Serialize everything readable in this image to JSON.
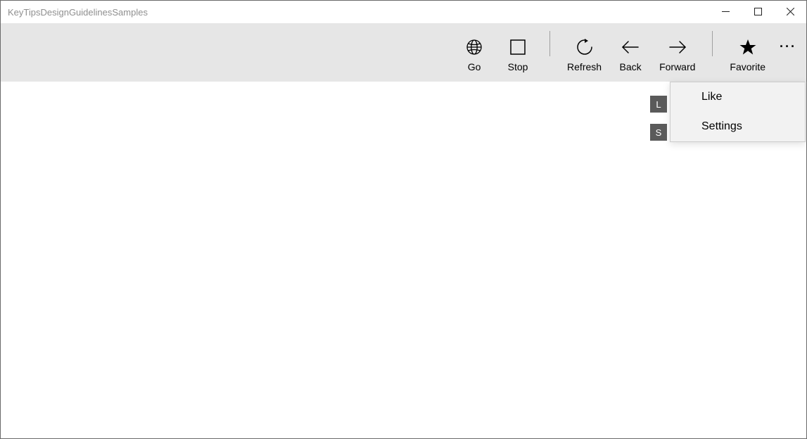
{
  "window": {
    "title": "KeyTipsDesignGuidelinesSamples"
  },
  "commandbar": {
    "go": "Go",
    "stop": "Stop",
    "refresh": "Refresh",
    "back": "Back",
    "forward": "Forward",
    "favorite": "Favorite"
  },
  "overflow": {
    "like": "Like",
    "settings": "Settings"
  },
  "keytips": {
    "like": "L",
    "settings": "S"
  }
}
